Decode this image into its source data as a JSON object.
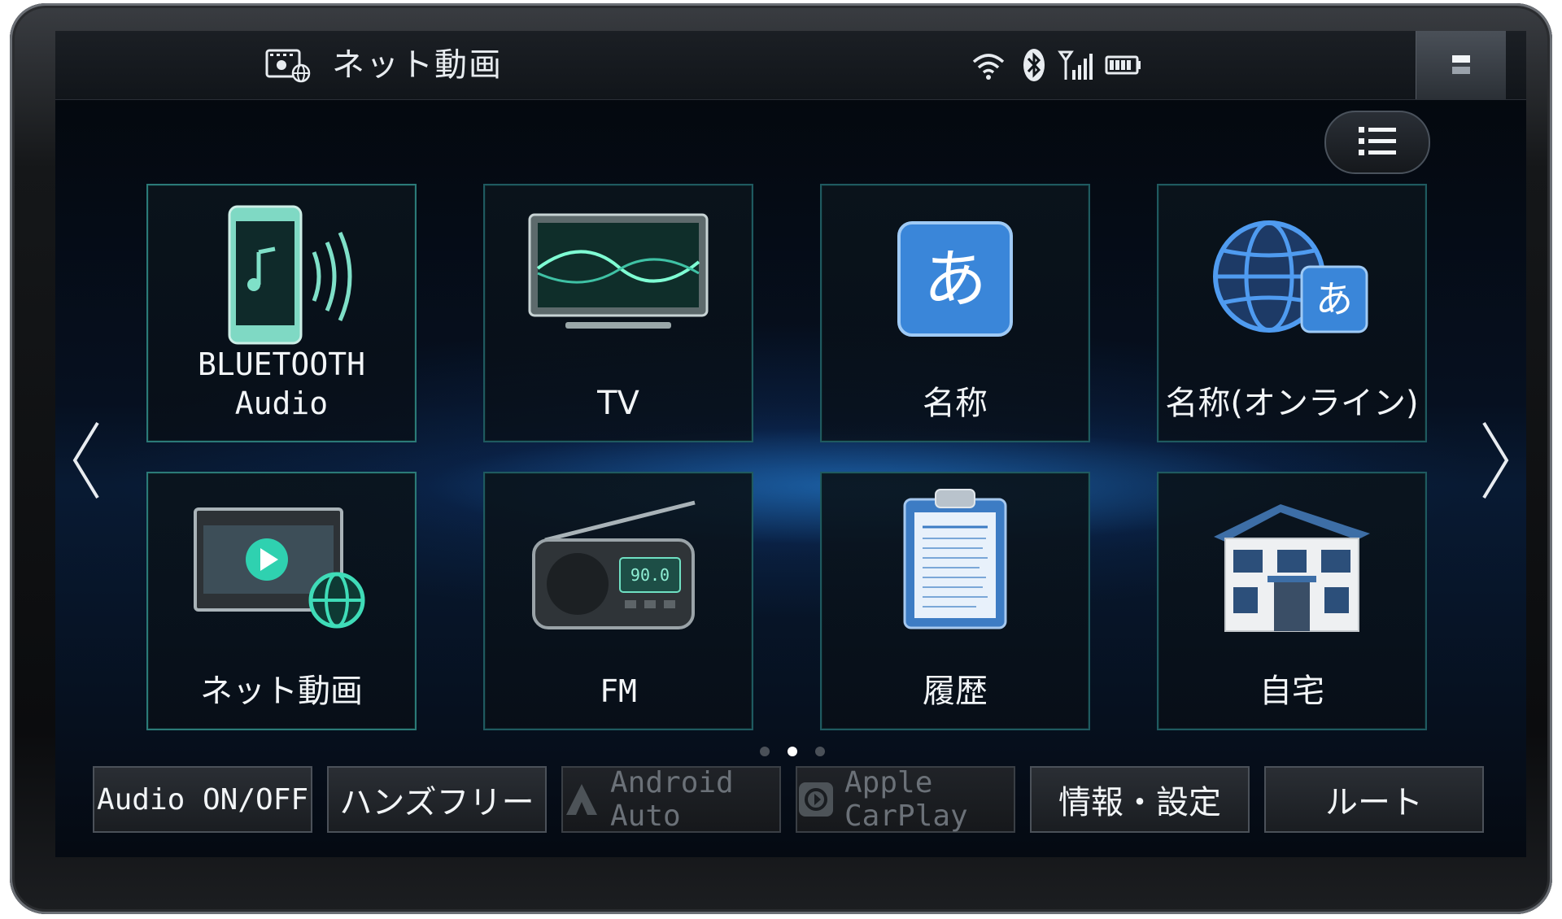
{
  "header": {
    "title": "ネット動画",
    "title_icon": "video-globe-icon",
    "status_icons": [
      "wifi-icon",
      "bluetooth-icon",
      "signal-icon",
      "battery-icon"
    ],
    "corner_icon": "display-toggle-icon"
  },
  "toolbar": {
    "menu_icon": "list-icon"
  },
  "tiles": [
    {
      "label": "BLUETOOTH Audio",
      "icon": "bluetooth-phone-audio-icon"
    },
    {
      "label": "TV",
      "icon": "tv-icon"
    },
    {
      "label": "名称",
      "icon": "hiragana-a-icon"
    },
    {
      "label": "名称(オンライン)",
      "icon": "globe-hiragana-icon"
    },
    {
      "label": "ネット動画",
      "icon": "video-globe-icon"
    },
    {
      "label": "FM",
      "icon": "radio-icon"
    },
    {
      "label": "履歴",
      "icon": "clipboard-history-icon"
    },
    {
      "label": "自宅",
      "icon": "house-icon"
    }
  ],
  "pager": {
    "pages": 3,
    "current": 2
  },
  "nav": {
    "prev_icon": "chevron-left-icon",
    "next_icon": "chevron-right-icon"
  },
  "bottom_buttons": [
    {
      "label": "Audio ON/OFF",
      "enabled": true
    },
    {
      "label": "ハンズフリー",
      "enabled": true
    },
    {
      "label": "Android Auto",
      "enabled": false,
      "icon": "android-auto-icon"
    },
    {
      "label": "Apple CarPlay",
      "enabled": false,
      "icon": "carplay-icon"
    },
    {
      "label": "情報・設定",
      "enabled": true
    },
    {
      "label": "ルート",
      "enabled": true
    }
  ],
  "tile_art_text": {
    "hiragana": "あ",
    "fm_display": "90.0"
  },
  "colors": {
    "accent": "#2b7a78",
    "glow": "#2a8fe6"
  }
}
